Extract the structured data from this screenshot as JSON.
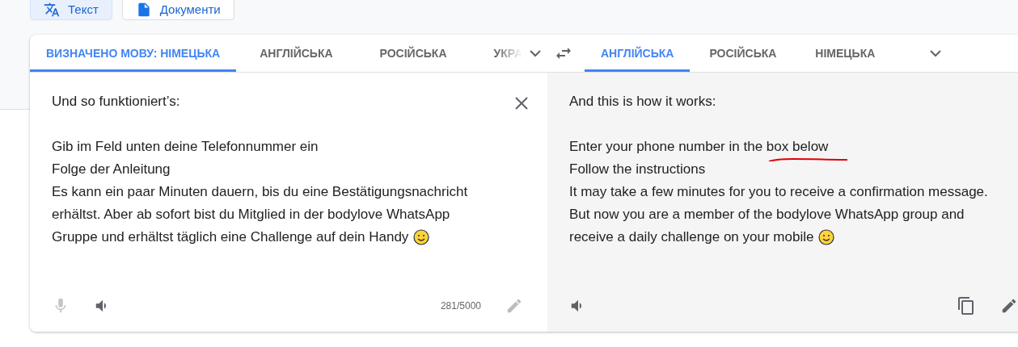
{
  "modes": [
    {
      "kind": "text",
      "label": "Текст",
      "selected": true
    },
    {
      "kind": "document",
      "label": "Документи",
      "selected": false
    }
  ],
  "source": {
    "tabs": [
      {
        "label": "ВИЗНАЧЕНО МОВУ: НІМЕЦЬКА",
        "selected": true
      },
      {
        "label": "АНГЛІЙСЬКА",
        "selected": false
      },
      {
        "label": "РОСІЙСЬКА",
        "selected": false
      },
      {
        "label": "УКРА",
        "selected": false
      }
    ],
    "paragraphs": [
      {
        "lines": [
          {
            "text": "Und so funktioniert’s:",
            "smiley": false
          }
        ]
      },
      {
        "lines": [
          {
            "text": "Gib im Feld unten deine Telefonnummer ein",
            "smiley": false
          },
          {
            "text": "Folge der Anleitung",
            "smiley": false
          },
          {
            "text": "Es kann ein paar Minuten dauern, bis du eine Bestätigungsnachricht",
            "smiley": false
          },
          {
            "text": "erhältst. Aber ab sofort bist du Mitglied in der bodylove WhatsApp",
            "smiley": false
          },
          {
            "text": "Gruppe und erhältst täglich eine Challenge auf dein Handy",
            "smiley": true
          }
        ]
      }
    ],
    "mic_disabled": true,
    "char_count": "281/5000"
  },
  "target": {
    "tabs": [
      {
        "label": "АНГЛІЙСЬКА",
        "selected": true
      },
      {
        "label": "РОСІЙСЬКА",
        "selected": false
      },
      {
        "label": "НІМЕЦЬКА",
        "selected": false
      }
    ],
    "paragraphs": [
      {
        "lines": [
          {
            "text": "And this is how it works:",
            "smiley": false
          }
        ]
      },
      {
        "lines": [
          {
            "text": "Enter your phone number in the box below",
            "smiley": false
          },
          {
            "text": "Follow the instructions",
            "smiley": false
          },
          {
            "text": "It may take a few minutes for you to receive a confirmation message.",
            "smiley": false
          },
          {
            "text": "But now you are a member of the bodylove WhatsApp group and",
            "smiley": false
          },
          {
            "text": "receive a daily challenge on your mobile",
            "smiley": true
          }
        ]
      }
    ]
  }
}
